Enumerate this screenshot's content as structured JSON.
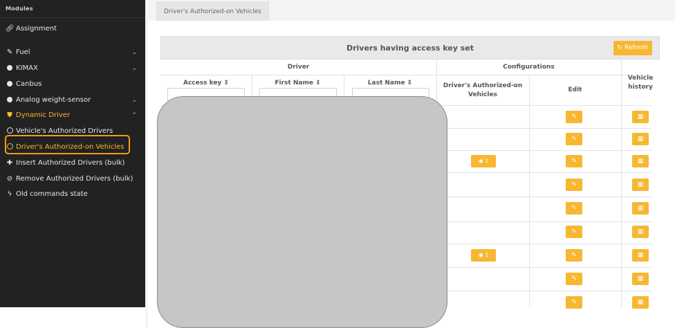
{
  "sidebar": {
    "header": "Modules",
    "items": [
      {
        "label": "Assignment",
        "icon": "link-icon"
      },
      {
        "label": "Fuel",
        "icon": "fuel-icon"
      },
      {
        "label": "KIMAX",
        "icon": "dot-icon"
      },
      {
        "label": "Canbus",
        "icon": "dot-icon"
      },
      {
        "label": "Analog weight-sensor",
        "icon": "dot-icon"
      },
      {
        "label": "Dynamic Driver",
        "icon": "shield-icon"
      },
      {
        "label": "Vehicle's Authorized Drivers",
        "icon": "circle-icon"
      },
      {
        "label": "Driver's Authorized-on Vehicles",
        "icon": "circle-icon"
      },
      {
        "label": "Insert Authorized Drivers (bulk)",
        "icon": "plus-icon"
      },
      {
        "label": "Remove Authorized Drivers (bulk)",
        "icon": "ban-icon"
      },
      {
        "label": "Old commands state",
        "icon": "bolt-icon"
      }
    ]
  },
  "tab": {
    "label": "Driver's Authorized-on Vehicles"
  },
  "table": {
    "title": "Drivers having access key set",
    "refresh_label": "Refresh",
    "group_driver": "Driver",
    "group_config": "Configurations",
    "col_access_key": "Access key",
    "col_first_name": "First Name",
    "col_last_name": "Last Name",
    "col_authorized": "Driver's Authorized-on Vehicles",
    "col_edit": "Edit",
    "col_history": "Vehicle history",
    "view_badges": [
      "1",
      "1"
    ]
  },
  "colors": {
    "accent": "#f7b731",
    "sidebar_bg": "#222222",
    "highlight": "#f39c12"
  }
}
